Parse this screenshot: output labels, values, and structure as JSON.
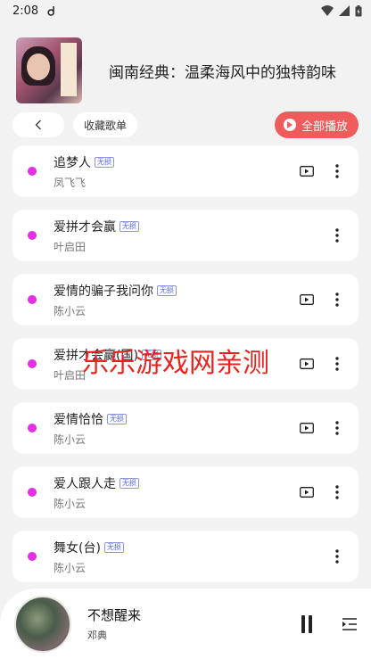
{
  "status_bar": {
    "time": "2:08",
    "notification_icon": "d-glyph-icon",
    "icons": [
      "wifi-icon",
      "signal-icon",
      "battery-icon"
    ]
  },
  "header": {
    "title": "闽南经典：温柔海风中的独特韵味",
    "cover_icon": "album-cover"
  },
  "toolbar": {
    "back_icon": "chevron-left-icon",
    "collect_label": "收藏歌单",
    "play_all_label": "全部播放"
  },
  "songs": [
    {
      "title": "追梦人",
      "badge": "无损",
      "artist": "凤飞飞",
      "has_mv": true
    },
    {
      "title": "爱拼才会赢",
      "badge": "无损",
      "artist": "叶启田",
      "has_mv": false
    },
    {
      "title": "爱情的骗子我问你",
      "badge": "无损",
      "artist": "陈小云",
      "has_mv": true
    },
    {
      "title": "爱拼才会赢(国)",
      "badge": "无损",
      "artist": "叶启田",
      "has_mv": true
    },
    {
      "title": "爱情恰恰",
      "badge": "无损",
      "artist": "陈小云",
      "has_mv": true
    },
    {
      "title": "爱人跟人走",
      "badge": "无损",
      "artist": "陈小云",
      "has_mv": true
    },
    {
      "title": "舞女(台)",
      "badge": "无损",
      "artist": "陈小云",
      "has_mv": false
    }
  ],
  "watermark": "乐乐游戏网亲测",
  "now_playing": {
    "title": "不想醒来",
    "artist": "邓典"
  },
  "colors": {
    "accent": "#f05b5b",
    "dot": "#e62ee6",
    "badge": "#5b6bd6",
    "watermark": "#e8231f"
  }
}
